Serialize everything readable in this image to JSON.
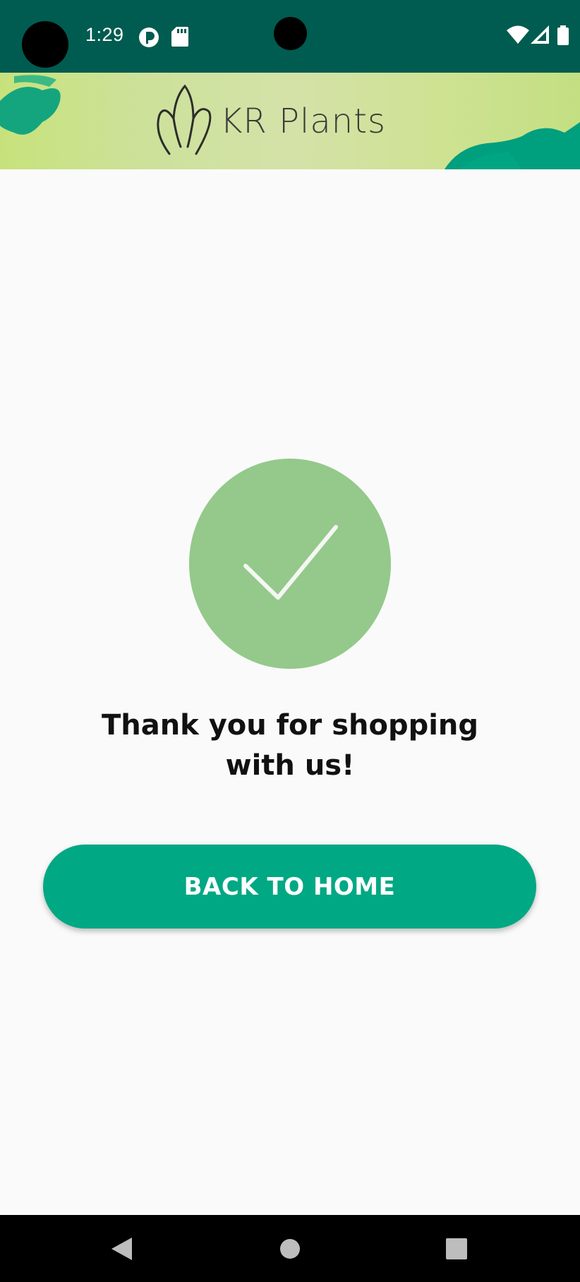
{
  "status_bar": {
    "time": "1:29",
    "icons": [
      "pocket-icon",
      "sd-card-icon",
      "wifi-icon",
      "signal-icon",
      "battery-icon"
    ]
  },
  "header": {
    "brand_name": "KR Plants",
    "logo": "leaf-logo-icon",
    "background_colors": [
      "#c7e27c",
      "#d4e2a8"
    ],
    "decoration_color": "#009f7e"
  },
  "success": {
    "icon": "checkmark-icon",
    "circle_color": "#94c98b",
    "message_line1": "Thank you for shopping",
    "message_line2": "with us!"
  },
  "actions": {
    "back_home_label": "BACK TO HOME",
    "button_color": "#00a884"
  },
  "nav_bar": {
    "buttons": [
      "back-icon",
      "home-icon",
      "recents-icon"
    ]
  }
}
